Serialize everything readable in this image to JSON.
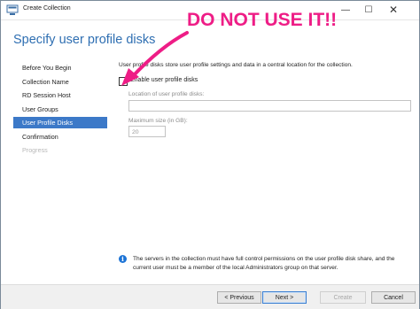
{
  "window": {
    "title": "Create Collection"
  },
  "titlebar": {
    "minimize": "—",
    "maximize": "☐",
    "close": "✕"
  },
  "page": {
    "heading": "Specify user profile disks"
  },
  "sidebar": {
    "items": [
      {
        "label": "Before You Begin",
        "state": "normal"
      },
      {
        "label": "Collection Name",
        "state": "normal"
      },
      {
        "label": "RD Session Host",
        "state": "normal"
      },
      {
        "label": "User Groups",
        "state": "normal"
      },
      {
        "label": "User Profile Disks",
        "state": "active"
      },
      {
        "label": "Confirmation",
        "state": "normal"
      },
      {
        "label": "Progress",
        "state": "disabled"
      }
    ]
  },
  "content": {
    "intro": "User profile disks store user profile settings and data in a central location for the collection.",
    "checkbox_label": "Enable user profile disks",
    "checkbox_checked": false,
    "location_label": "Location of user profile disks:",
    "location_value": "",
    "max_size_label": "Maximum size (in GB):",
    "max_size_value": "20"
  },
  "info": {
    "icon": "info-icon",
    "text": "The servers in the collection must have full control permissions on the user profile disk share, and the current user must be a member of the local Administrators group on that server."
  },
  "footer": {
    "previous": "< Previous",
    "next": "Next >",
    "create": "Create",
    "cancel": "Cancel"
  },
  "annotation": {
    "text": "DO NOT USE IT!!",
    "color": "#ee1d86"
  },
  "colors": {
    "accent": "#3c79c8",
    "heading": "#2f6fb2",
    "info": "#1d74d6"
  }
}
